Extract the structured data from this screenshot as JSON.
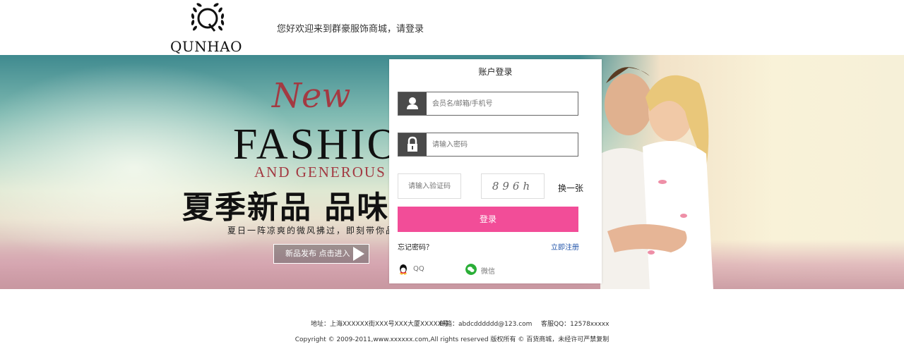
{
  "header": {
    "logo_text": "QUNHAO",
    "welcome": "您好欢迎来到群豪服饰商城，请登录"
  },
  "banner": {
    "new": "New",
    "fashion": "FASHION",
    "generous": "AND GENEROUS",
    "headline": "夏季新品 品味",
    "subline": "夏日一阵凉爽的微风拂过，即刻带你品味",
    "cta": "新品发布 点击进入"
  },
  "login": {
    "title": "账户登录",
    "username_placeholder": "会员名/邮箱/手机号",
    "password_placeholder": "请输入密码",
    "captcha_placeholder": "请输入验证码",
    "captcha_code": "896h",
    "refresh_label": "换一张",
    "submit_label": "登录",
    "forgot_label": "忘记密码？",
    "register_label": "立即注册",
    "qq_label": "QQ",
    "wechat_label": "微信"
  },
  "footer": {
    "address": "地址：上海XXXXXX街XXX号XXX大厦XXXXX号",
    "email": "邮箱：abdcdddddd@123.com",
    "service_qq": "客服QQ：12578xxxxx",
    "copyright": "Copyright © 2009-2011,www.xxxxxx.com,All rights reserved 版权所有 © 百货商城，未经许可严禁复制"
  },
  "colors": {
    "accent_pink": "#f24d98",
    "icon_dark": "#4a4a4a",
    "link_blue": "#2255aa",
    "qq_yellow": "#f5c023",
    "wechat_green": "#2aae37"
  },
  "icons": {
    "user": "user-icon",
    "lock": "lock-icon",
    "qq": "qq-icon",
    "wechat": "wechat-icon",
    "play": "play-icon"
  }
}
